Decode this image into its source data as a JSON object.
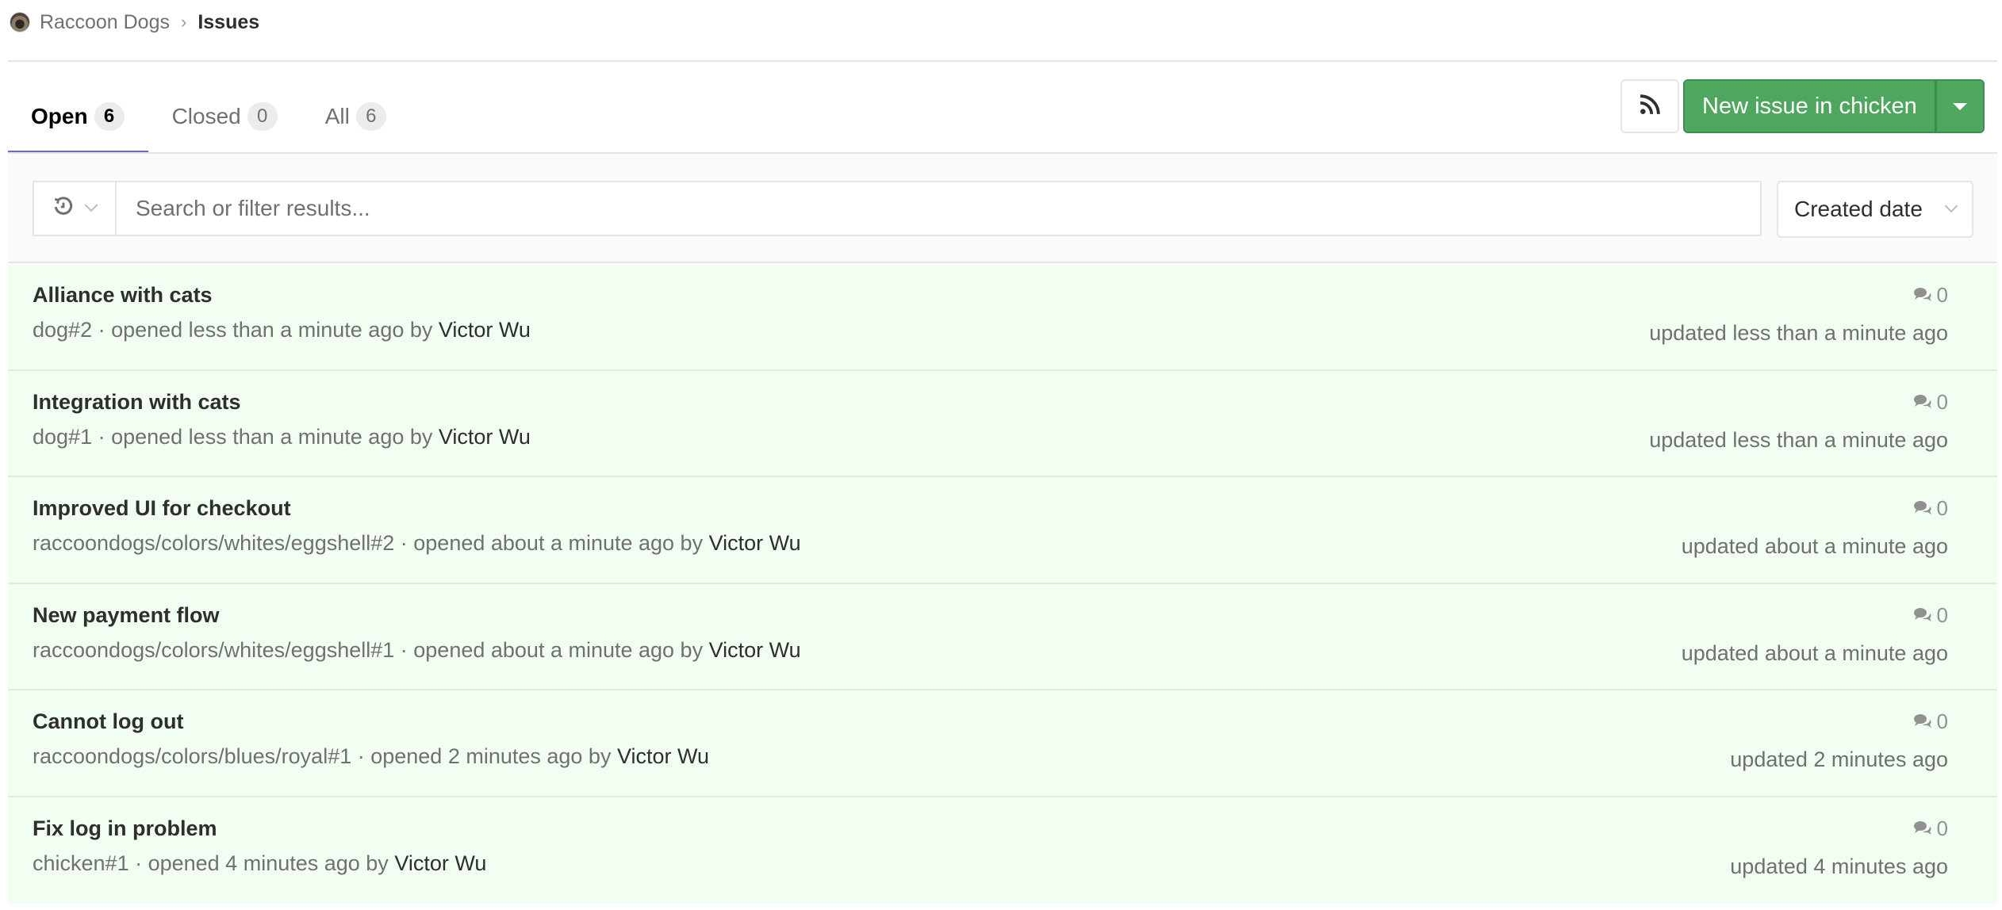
{
  "breadcrumb": {
    "group": "Raccoon Dogs",
    "separator": "›",
    "current": "Issues"
  },
  "tabs": [
    {
      "label": "Open",
      "count": "6",
      "active": true
    },
    {
      "label": "Closed",
      "count": "0",
      "active": false
    },
    {
      "label": "All",
      "count": "6",
      "active": false
    }
  ],
  "toolbar": {
    "rss_icon": "rss-icon",
    "new_issue_label": "New issue in chicken",
    "accent": "#4fa65e"
  },
  "filter": {
    "history_icon": "history-icon",
    "search_placeholder": "Search or filter results...",
    "search_value": "",
    "sort_label": "Created date"
  },
  "issues": [
    {
      "title": "Alliance with cats",
      "ref": "dog#2",
      "opened": " · opened less than a minute ago by ",
      "author": "Victor Wu",
      "comments": "0",
      "updated": "updated less than a minute ago"
    },
    {
      "title": "Integration with cats",
      "ref": "dog#1",
      "opened": " · opened less than a minute ago by ",
      "author": "Victor Wu",
      "comments": "0",
      "updated": "updated less than a minute ago"
    },
    {
      "title": "Improved UI for checkout",
      "ref": "raccoondogs/colors/whites/eggshell#2",
      "opened": " · opened about a minute ago by ",
      "author": "Victor Wu",
      "comments": "0",
      "updated": "updated about a minute ago"
    },
    {
      "title": "New payment flow",
      "ref": "raccoondogs/colors/whites/eggshell#1",
      "opened": " · opened about a minute ago by ",
      "author": "Victor Wu",
      "comments": "0",
      "updated": "updated about a minute ago"
    },
    {
      "title": "Cannot log out",
      "ref": "raccoondogs/colors/blues/royal#1",
      "opened": " · opened 2 minutes ago by ",
      "author": "Victor Wu",
      "comments": "0",
      "updated": "updated 2 minutes ago"
    },
    {
      "title": "Fix log in problem",
      "ref": "chicken#1",
      "opened": " · opened 4 minutes ago by ",
      "author": "Victor Wu",
      "comments": "0",
      "updated": "updated 4 minutes ago"
    }
  ]
}
